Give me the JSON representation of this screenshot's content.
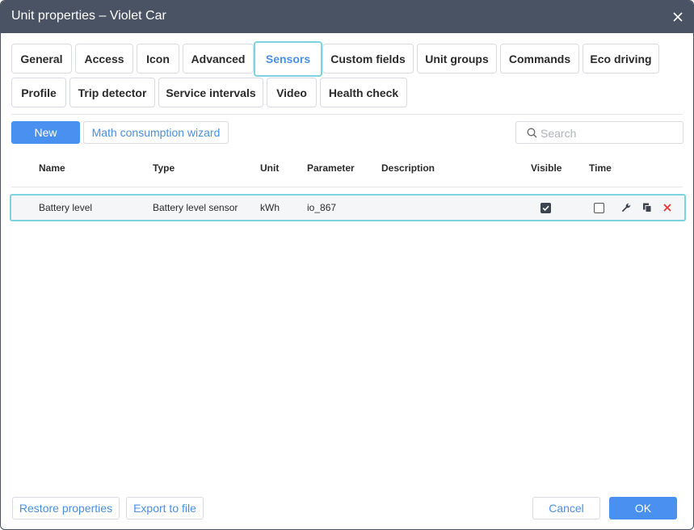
{
  "window": {
    "title": "Unit properties – Violet Car"
  },
  "tabs": [
    {
      "label": "General"
    },
    {
      "label": "Access"
    },
    {
      "label": "Icon"
    },
    {
      "label": "Advanced"
    },
    {
      "label": "Sensors",
      "active": true
    },
    {
      "label": "Custom fields"
    },
    {
      "label": "Unit groups"
    },
    {
      "label": "Commands"
    },
    {
      "label": "Eco driving"
    },
    {
      "label": "Profile"
    },
    {
      "label": "Trip detector"
    },
    {
      "label": "Service intervals"
    },
    {
      "label": "Video"
    },
    {
      "label": "Health check"
    }
  ],
  "toolbar": {
    "new_label": "New",
    "wizard_label": "Math consumption wizard",
    "search_placeholder": "Search",
    "search_value": ""
  },
  "table": {
    "columns": {
      "name": "Name",
      "type": "Type",
      "unit": "Unit",
      "parameter": "Parameter",
      "description": "Description",
      "visible": "Visible",
      "time": "Time"
    },
    "rows": [
      {
        "name": "Battery level",
        "type": "Battery level sensor",
        "unit": "kWh",
        "parameter": "io_867",
        "description": "",
        "visible": true,
        "time": false
      }
    ]
  },
  "footer": {
    "restore_label": "Restore properties",
    "export_label": "Export to file",
    "cancel_label": "Cancel",
    "ok_label": "OK"
  },
  "colors": {
    "titlebar": "#4a5363",
    "primary": "#4a90f0",
    "active_tab_border": "#7dd3e0",
    "link_text": "#4a90e2",
    "delete": "#e53935"
  },
  "icons": [
    "close-icon",
    "search-icon",
    "wrench-icon",
    "copy-icon",
    "delete-icon"
  ]
}
